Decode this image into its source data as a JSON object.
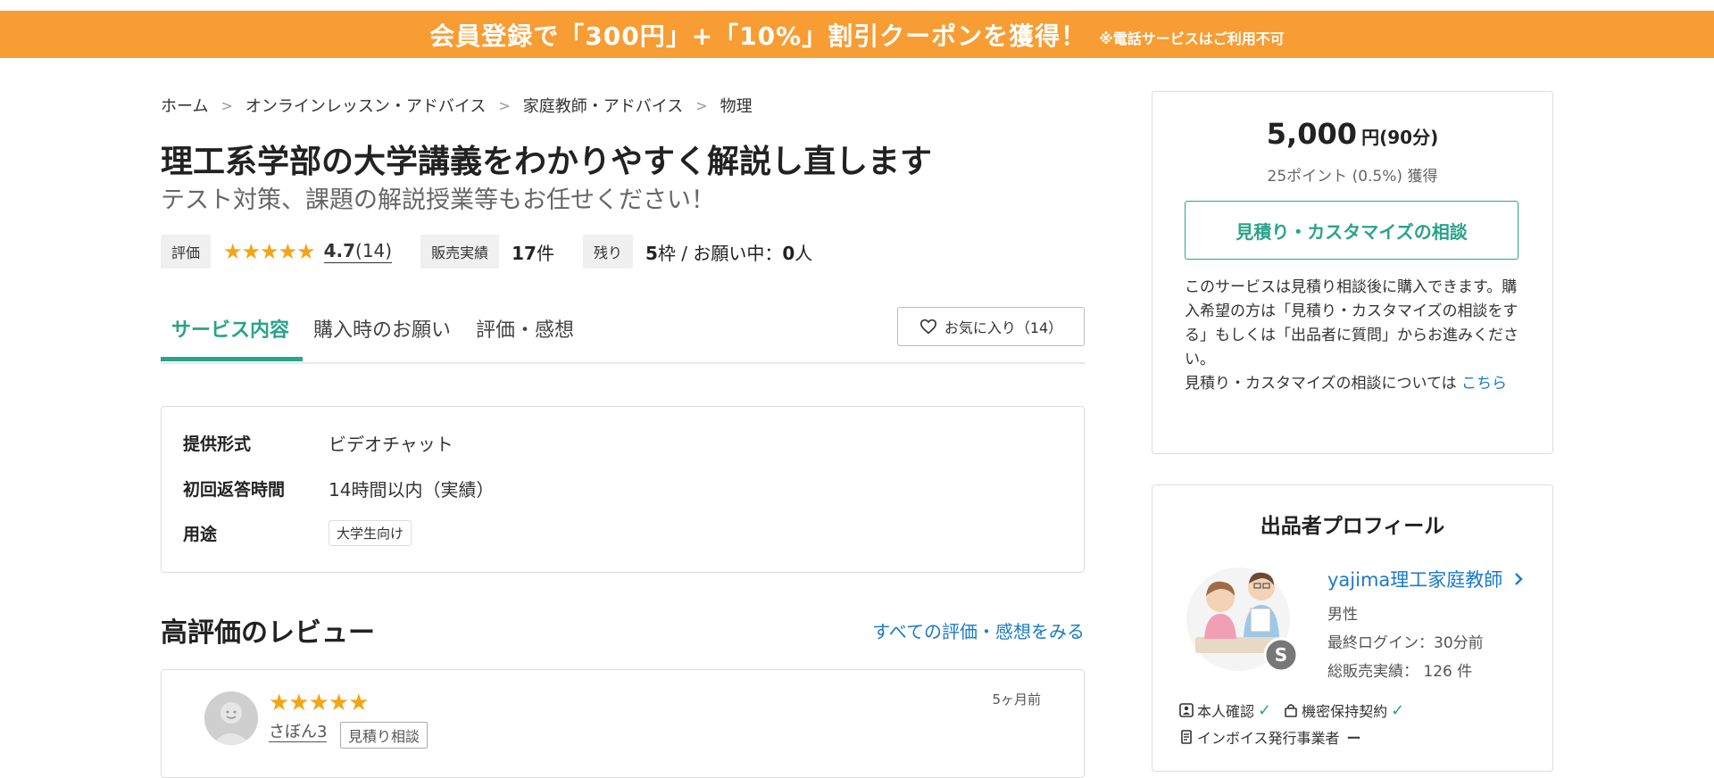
{
  "banner": {
    "main": "会員登録で「300円」+「10%」割引クーポンを獲得！",
    "note": "※電話サービスはご利用不可"
  },
  "breadcrumb": [
    "ホーム",
    "オンラインレッスン・アドバイス",
    "家庭教師・アドバイス",
    "物理"
  ],
  "breadcrumb_sep": ">",
  "service": {
    "title": "理工系学部の大学講義をわかりやすく解説し直します",
    "subtitle": "テスト対策、課題の解説授業等もお任せください！"
  },
  "stats": {
    "rating_label": "評価",
    "stars": "★★★★★",
    "rating_value": "4.7",
    "rating_count": "(14)",
    "sales_label": "販売実績",
    "sales_value": "17",
    "sales_unit": "件",
    "remaining_label": "残り",
    "remaining_value": "5",
    "remaining_unit": "枠 / お願い中：",
    "requests_value": "0",
    "requests_unit": "人"
  },
  "tabs": [
    {
      "label": "サービス内容"
    },
    {
      "label": "購入時のお願い"
    },
    {
      "label": "評価・感想"
    }
  ],
  "favorite": {
    "label": "お気に入り（14）"
  },
  "info": {
    "format_label": "提供形式",
    "format_value": "ビデオチャット",
    "response_label": "初回返答時間",
    "response_value": "14時間以内（実績）",
    "purpose_label": "用途",
    "purpose_value": "大学生向け"
  },
  "reviews": {
    "heading": "高評価のレビュー",
    "see_all": "すべての評価・感想をみる",
    "items": [
      {
        "stars": "★★★★★",
        "user": "さぼん3",
        "tag": "見積り相談",
        "date": "5ヶ月前"
      }
    ]
  },
  "price_card": {
    "price": "5,000",
    "unit": "円(90分)",
    "points": "25ポイント (0.5%) 獲得",
    "quote_button": "見積り・カスタマイズの相談",
    "desc1": "このサービスは見積り相談後に購入できます。購入希望の方は「見積り・カスタマイズの相談をする」もしくは「出品者に質問」からお進みください。",
    "desc2": "見積り・カスタマイズの相談については ",
    "desc_link": "こちら"
  },
  "profile": {
    "title": "出品者プロフィール",
    "name": "yajima理工家庭教師",
    "gender": "男性",
    "last_login": "最終ログイン：30分前",
    "total_sales": "総販売実績： 126 件",
    "badge_identity": "本人確認",
    "badge_nda": "機密保持契約",
    "badge_invoice": "インボイス発行事業者",
    "badge_invoice_status": "ー"
  },
  "colors": {
    "accent": "#2aa38a",
    "banner": "#f79d33",
    "link": "#1a7ac9",
    "star": "#f2a516"
  }
}
